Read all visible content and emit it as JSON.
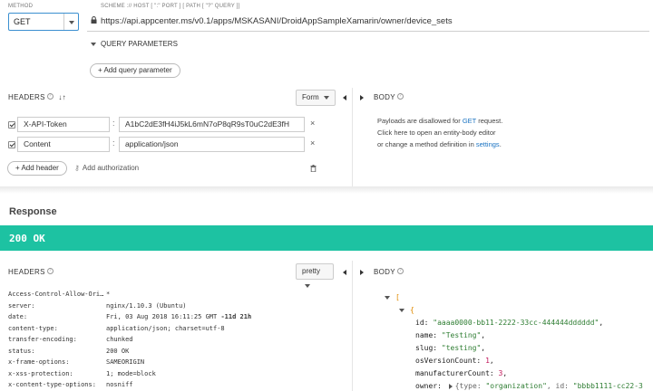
{
  "request": {
    "method_label": "METHOD",
    "url_label": "SCHEME :// HOST [ \":\" PORT ] [ PATH [ \"?\" QUERY ]]",
    "method": "GET",
    "url": "https://api.appcenter.ms/v0.1/apps/MSKASANI/DroidAppSampleXamarin/owner/device_sets",
    "query_params_label": "QUERY PARAMETERS",
    "add_query_param": "+ Add query parameter",
    "headers_title": "HEADERS",
    "form_dropdown": "Form",
    "headers": [
      {
        "name": "X-API-Token",
        "value": "A1bC2dE3fH4iJ5kL6mN7oP8qR9sT0uC2dE3fH"
      },
      {
        "name": "Content",
        "value": "application/json"
      }
    ],
    "add_header": "+ Add header",
    "add_authorization": "Add authorization",
    "body_title": "BODY",
    "body_info_line1_a": "Payloads are disallowed for ",
    "body_info_line1_b": "GET",
    "body_info_line1_c": " request.",
    "body_info_line2": "Click here to open an entity-body editor",
    "body_info_line3_a": "or change a method definition in ",
    "body_info_line3_b": "settings",
    "body_info_line3_c": "."
  },
  "response": {
    "title": "Response",
    "status": "200 OK",
    "headers_title": "HEADERS",
    "pretty_dropdown": "pretty",
    "body_title": "BODY",
    "headers": [
      {
        "name": "Access-Control-Allow-Ori…",
        "value": "*"
      },
      {
        "name": "server:",
        "value": "nginx/1.10.3 (Ubuntu)"
      },
      {
        "name": "date:",
        "value": "Fri, 03 Aug 2018 16:11:25 GMT"
      },
      {
        "name": "content-type:",
        "value": "application/json; charset=utf-8"
      },
      {
        "name": "transfer-encoding:",
        "value": "chunked"
      },
      {
        "name": "status:",
        "value": "200 OK"
      },
      {
        "name": "x-frame-options:",
        "value": "SAMEORIGIN"
      },
      {
        "name": "x-xss-protection:",
        "value": "1; mode=block"
      },
      {
        "name": "x-content-type-options:",
        "value": "nosniff"
      }
    ],
    "date_extra": "-11d 21h",
    "json": {
      "open_array": "[",
      "open_obj": "{",
      "id_key": "id:",
      "id_val": "\"aaaa0000-bb11-2222-33cc-444444dddddd\"",
      "name_key": "name:",
      "name_val": "\"Testing\"",
      "slug_key": "slug:",
      "slug_val": "\"testing\"",
      "osv_key": "osVersionCount:",
      "osv_val": "1",
      "mfr_key": "manufacturerCount:",
      "mfr_val": "3",
      "owner_key": "owner:",
      "owner_preview_a": "{type: ",
      "owner_preview_b": "\"organization\"",
      "owner_preview_c": ", id: ",
      "owner_preview_d": "\"bbbb1111-cc22-3"
    }
  },
  "colors": {
    "status_bar": "#1dc2a2",
    "link": "#1a73c2",
    "method_border": "#3b8fd0"
  }
}
